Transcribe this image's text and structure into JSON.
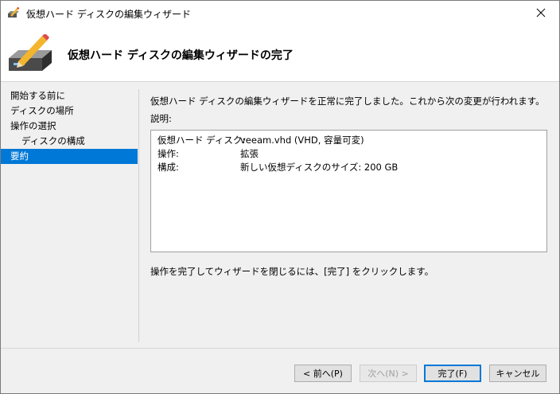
{
  "window": {
    "title": "仮想ハード ディスクの編集ウィザード",
    "close_label": "✕"
  },
  "header": {
    "title": "仮想ハード ディスクの編集ウィザードの完了",
    "icon": "hard-disk-pencil-icon"
  },
  "sidebar": {
    "items": [
      {
        "label": "開始する前に"
      },
      {
        "label": "ディスクの場所"
      },
      {
        "label": "操作の選択"
      },
      {
        "label": "ディスクの構成"
      },
      {
        "label": "要約"
      }
    ],
    "active_index": 4
  },
  "main": {
    "intro": "仮想ハード ディスクの編集ウィザードを正常に完了しました。これから次の変更が行われます。",
    "description_label": "説明:",
    "details": [
      {
        "key": "仮想ハード ディスク:",
        "value": "veeam.vhd (VHD, 容量可変)"
      },
      {
        "key": "操作:",
        "value": "拡張"
      },
      {
        "key": "構成:",
        "value": "新しい仮想ディスクのサイズ: 200 GB"
      }
    ],
    "footer_text": "操作を完了してウィザードを閉じるには、[完了] をクリックします。"
  },
  "buttons": {
    "back": "< 前へ(P)",
    "next": "次へ(N) >",
    "finish": "完了(F)",
    "cancel": "キャンセル"
  },
  "colors": {
    "selection": "#0078d7"
  }
}
